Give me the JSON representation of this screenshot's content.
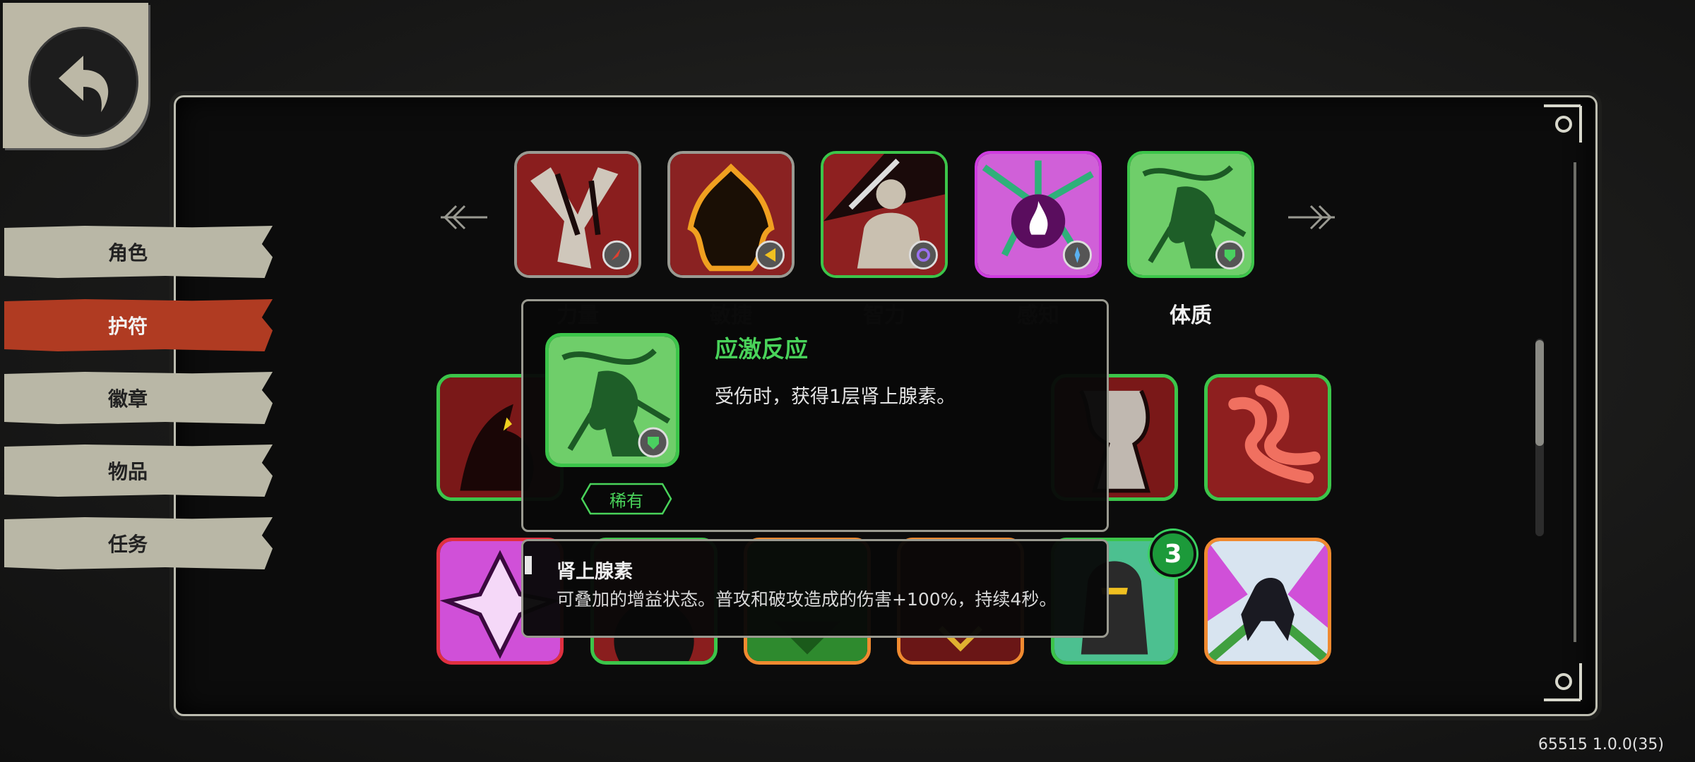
{
  "nav": {
    "items": [
      {
        "label": "角色",
        "active": false
      },
      {
        "label": "护符",
        "active": true
      },
      {
        "label": "徽章",
        "active": false
      },
      {
        "label": "物品",
        "active": false
      },
      {
        "label": "任务",
        "active": false
      }
    ]
  },
  "categories": [
    {
      "label": "力量",
      "icon": "strength-charm-icon",
      "selected": false
    },
    {
      "label": "敏捷",
      "icon": "agility-charm-icon",
      "selected": false
    },
    {
      "label": "智力",
      "icon": "intelligence-charm-icon",
      "selected": false
    },
    {
      "label": "感知",
      "icon": "perception-charm-icon",
      "selected": false
    },
    {
      "label": "体质",
      "icon": "constitution-charm-icon",
      "selected": true
    }
  ],
  "charm_grid": {
    "badge_count": "3"
  },
  "detail": {
    "name": "应激反应",
    "description": "受伤时，获得1层肾上腺素。",
    "rarity": "稀有"
  },
  "tooltip": {
    "title": "肾上腺素",
    "description": "可叠加的增益状态。普攻和破攻造成的伤害+100%，持续4秒。"
  },
  "version": "65515 1.0.0(35)",
  "colors": {
    "accent_active": "#b03b22",
    "rarity_green": "#49d35a",
    "nav_tab": "#b9b7a6"
  }
}
